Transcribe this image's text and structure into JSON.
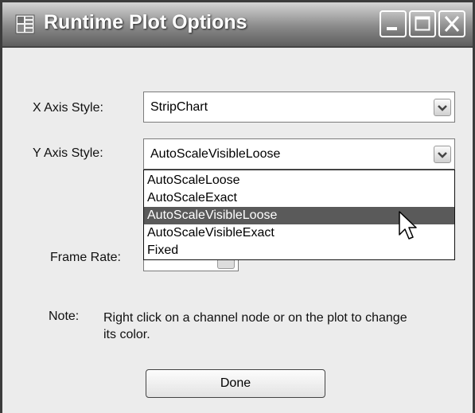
{
  "window": {
    "title": "Runtime Plot Options",
    "app_icon": "window-grid-icon",
    "controls": [
      "minimize-icon",
      "maximize-icon",
      "close-icon"
    ]
  },
  "x_axis": {
    "label": "X Axis Style:",
    "value": "StripChart"
  },
  "y_axis": {
    "label": "Y Axis Style:",
    "value": "AutoScaleVisibleLoose",
    "options": [
      "AutoScaleLoose",
      "AutoScaleExact",
      "AutoScaleVisibleLoose",
      "AutoScaleVisibleExact",
      "Fixed"
    ],
    "highlighted_option": "AutoScaleVisibleLoose"
  },
  "frame_rate": {
    "label": "Frame Rate:"
  },
  "note": {
    "label": "Note:",
    "text": "Right click on a channel node or on the plot to change its color."
  },
  "done_button": {
    "label": "Done"
  },
  "colors": {
    "selection": "#5a5a5a",
    "titlebar": "#8a8a8a"
  }
}
